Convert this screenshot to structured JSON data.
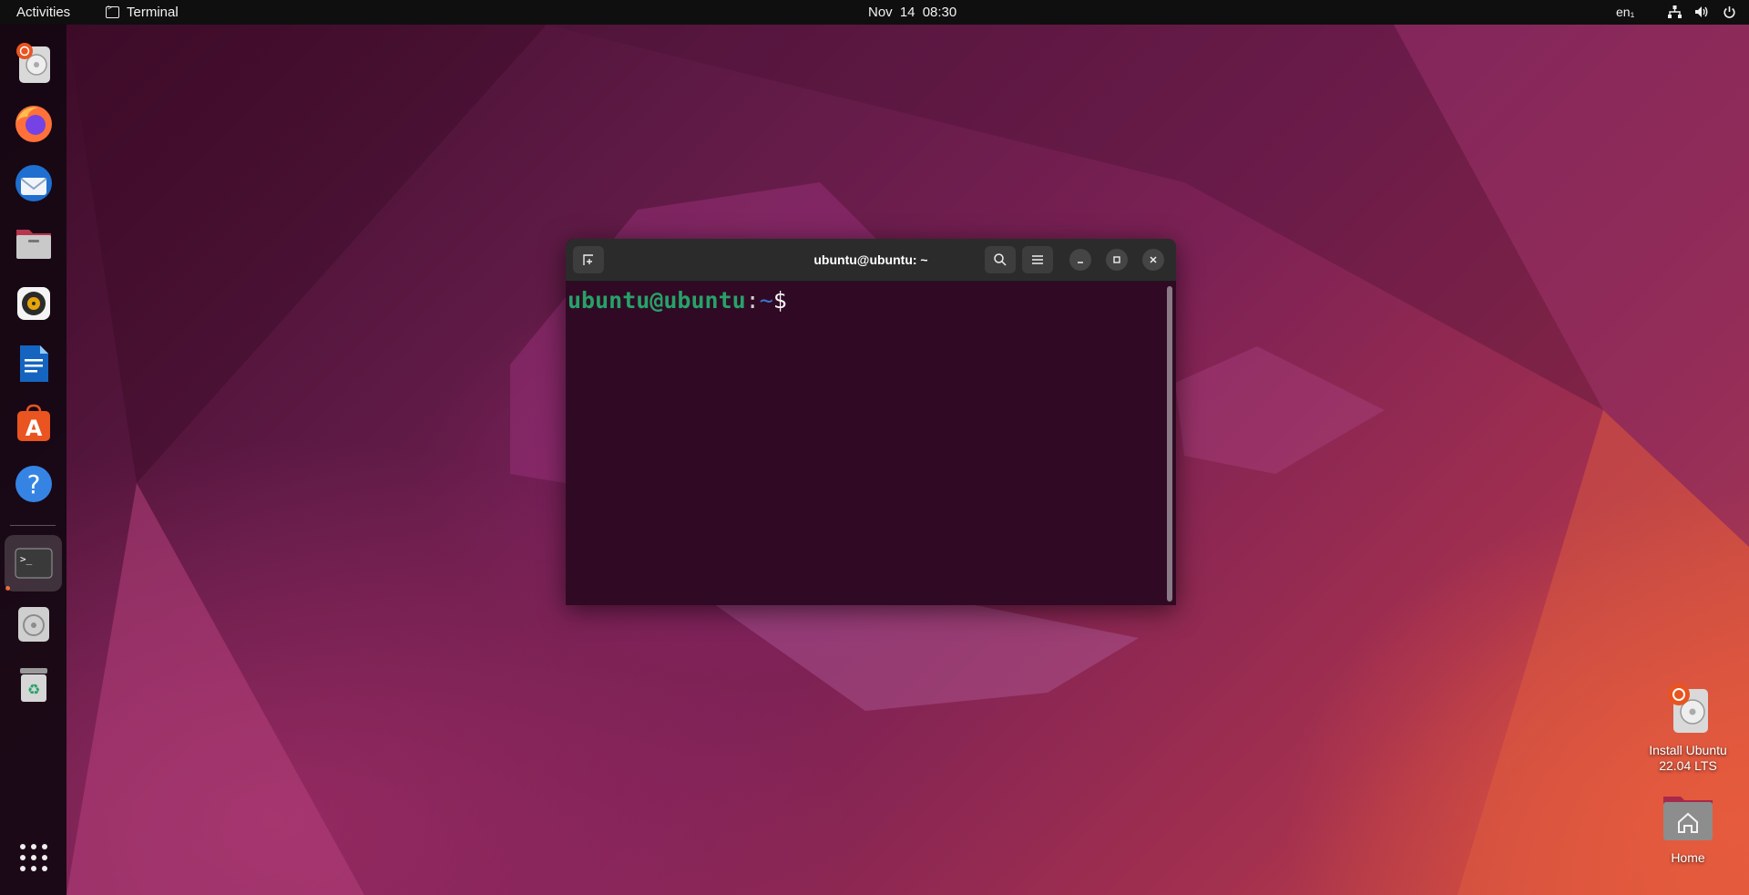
{
  "topbar": {
    "activities": "Activities",
    "app_name": "Terminal",
    "clock": "Nov 14  08:30",
    "language": "en₁",
    "status_icons": [
      "network-icon",
      "volume-icon",
      "power-icon"
    ]
  },
  "dock": {
    "items": [
      {
        "name": "Install Ubuntu",
        "icon": "install-ubuntu-icon"
      },
      {
        "name": "Firefox",
        "icon": "firefox-icon"
      },
      {
        "name": "Thunderbird",
        "icon": "thunderbird-icon"
      },
      {
        "name": "Files",
        "icon": "files-icon"
      },
      {
        "name": "Rhythmbox",
        "icon": "rhythmbox-icon"
      },
      {
        "name": "LibreOffice Writer",
        "icon": "writer-icon"
      },
      {
        "name": "Ubuntu Software",
        "icon": "software-icon"
      },
      {
        "name": "Help",
        "icon": "help-icon"
      },
      {
        "name": "Terminal",
        "icon": "terminal-icon",
        "active": true
      },
      {
        "name": "Disc",
        "icon": "disc-icon"
      },
      {
        "name": "Trash",
        "icon": "trash-icon"
      }
    ],
    "show_apps_icon": "app-grid-icon"
  },
  "terminal": {
    "title": "ubuntu@ubuntu: ~",
    "prompt_user": "ubuntu@ubuntu",
    "prompt_colon": ":",
    "prompt_path": "~",
    "prompt_symbol": "$",
    "colors": {
      "user": "#26a269",
      "path": "#3a78d8",
      "background": "#300a24"
    }
  },
  "desktop": {
    "install_label_line1": "Install Ubuntu",
    "install_label_line2": "22.04 LTS",
    "home_label": "Home"
  },
  "colors": {
    "accent": "#e95420",
    "topbar": "#0f0f0f"
  }
}
